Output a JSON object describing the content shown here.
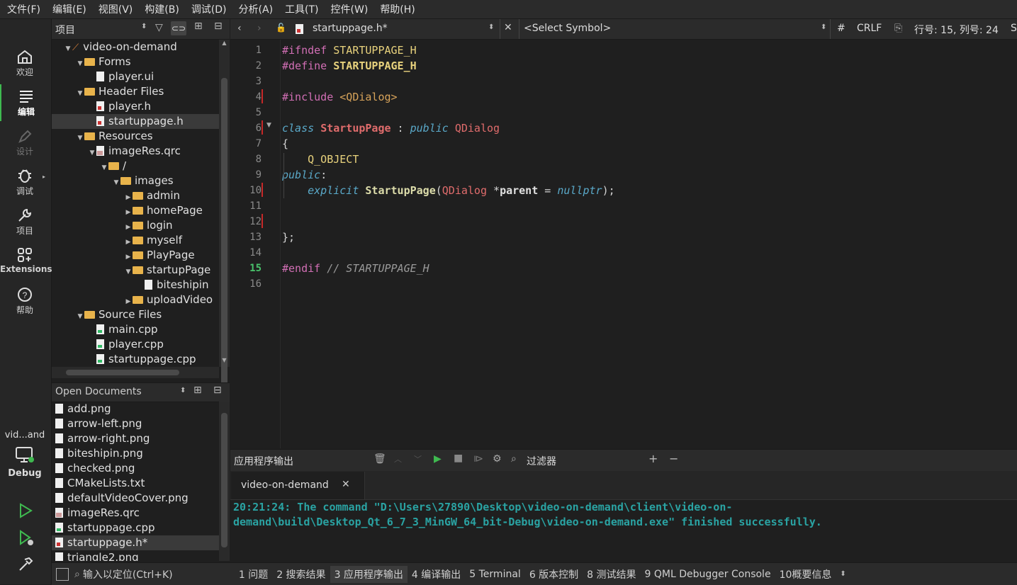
{
  "menu": [
    "文件(F)",
    "编辑(E)",
    "视图(V)",
    "构建(B)",
    "调试(D)",
    "分析(A)",
    "工具(T)",
    "控件(W)",
    "帮助(H)"
  ],
  "modes": [
    {
      "label": "欢迎",
      "icon": "home-icon"
    },
    {
      "label": "编辑",
      "icon": "edit-icon"
    },
    {
      "label": "设计",
      "icon": "design-icon"
    },
    {
      "label": "调试",
      "icon": "debug-icon"
    },
    {
      "label": "项目",
      "icon": "wrench-icon"
    },
    {
      "label": "Extensions",
      "icon": "extensions-icon"
    },
    {
      "label": "帮助",
      "icon": "help-icon"
    }
  ],
  "kit": {
    "project": "vid...and",
    "build": "Debug"
  },
  "project_panel": {
    "title": "项目",
    "tree": [
      {
        "label": "video-on-demand",
        "depth": 0,
        "kind": "project",
        "arrow": "down"
      },
      {
        "label": "Forms",
        "depth": 1,
        "kind": "folder",
        "arrow": "down"
      },
      {
        "label": "player.ui",
        "depth": 2,
        "kind": "file",
        "arrow": ""
      },
      {
        "label": "Header Files",
        "depth": 1,
        "kind": "folder",
        "arrow": "down"
      },
      {
        "label": "player.h",
        "depth": 2,
        "kind": "h",
        "arrow": ""
      },
      {
        "label": "startuppage.h",
        "depth": 2,
        "kind": "h",
        "arrow": "",
        "selected": true
      },
      {
        "label": "Resources",
        "depth": 1,
        "kind": "folder",
        "arrow": "down"
      },
      {
        "label": "imageRes.qrc",
        "depth": 2,
        "kind": "qrc",
        "arrow": "down"
      },
      {
        "label": "/",
        "depth": 3,
        "kind": "folder",
        "arrow": "down"
      },
      {
        "label": "images",
        "depth": 4,
        "kind": "folder",
        "arrow": "down"
      },
      {
        "label": "admin",
        "depth": 5,
        "kind": "folder",
        "arrow": "right"
      },
      {
        "label": "homePage",
        "depth": 5,
        "kind": "folder",
        "arrow": "right"
      },
      {
        "label": "login",
        "depth": 5,
        "kind": "folder",
        "arrow": "right"
      },
      {
        "label": "myself",
        "depth": 5,
        "kind": "folder",
        "arrow": "right"
      },
      {
        "label": "PlayPage",
        "depth": 5,
        "kind": "folder",
        "arrow": "right"
      },
      {
        "label": "startupPage",
        "depth": 5,
        "kind": "folder",
        "arrow": "down"
      },
      {
        "label": "biteshipin",
        "depth": 6,
        "kind": "file",
        "arrow": ""
      },
      {
        "label": "uploadVideo",
        "depth": 5,
        "kind": "folder",
        "arrow": "right"
      },
      {
        "label": "Source Files",
        "depth": 1,
        "kind": "folder",
        "arrow": "down"
      },
      {
        "label": "main.cpp",
        "depth": 2,
        "kind": "cpp",
        "arrow": ""
      },
      {
        "label": "player.cpp",
        "depth": 2,
        "kind": "cpp",
        "arrow": ""
      },
      {
        "label": "startuppage.cpp",
        "depth": 2,
        "kind": "cpp",
        "arrow": ""
      }
    ]
  },
  "open_documents": {
    "title": "Open Documents",
    "items": [
      {
        "label": "add.png",
        "kind": "file"
      },
      {
        "label": "arrow-left.png",
        "kind": "file"
      },
      {
        "label": "arrow-right.png",
        "kind": "file"
      },
      {
        "label": "biteshipin.png",
        "kind": "file"
      },
      {
        "label": "checked.png",
        "kind": "file"
      },
      {
        "label": "CMakeLists.txt",
        "kind": "file"
      },
      {
        "label": "defaultVideoCover.png",
        "kind": "file"
      },
      {
        "label": "imageRes.qrc",
        "kind": "qrc"
      },
      {
        "label": "startuppage.cpp",
        "kind": "cpp"
      },
      {
        "label": "startuppage.h*",
        "kind": "h",
        "selected": true
      },
      {
        "label": "triangle2.png",
        "kind": "file"
      }
    ]
  },
  "editor": {
    "file": "startuppage.h*",
    "symbol": "<Select Symbol>",
    "hash": "#",
    "line_ending": "CRLF",
    "position": "行号: 15, 列号: 24",
    "trailing": "S",
    "line_numbers": [
      "1",
      "2",
      "3",
      "4",
      "5",
      "6",
      "7",
      "8",
      "9",
      "10",
      "11",
      "12",
      "13",
      "14",
      "15",
      "16"
    ],
    "current_line": 15
  },
  "output": {
    "title": "应用程序输出",
    "filter": "过滤器",
    "tab": "video-on-demand",
    "lines": [
      "20:21:24: The command \"D:\\Users\\27890\\Desktop\\video-on-demand\\client\\video-on-",
      "demand\\build\\Desktop_Qt_6_7_3_MinGW_64_bit-Debug\\video-on-demand.exe\" finished successfully."
    ]
  },
  "bottom": {
    "locator": "输入以定位(Ctrl+K)",
    "tabs": [
      "1 问题",
      "2 搜索结果",
      "3 应用程序输出",
      "4 编译输出",
      "5 Terminal",
      "6 版本控制",
      "8 测试结果",
      "9 QML Debugger Console",
      "10概要信息"
    ],
    "active_tab": 2
  }
}
